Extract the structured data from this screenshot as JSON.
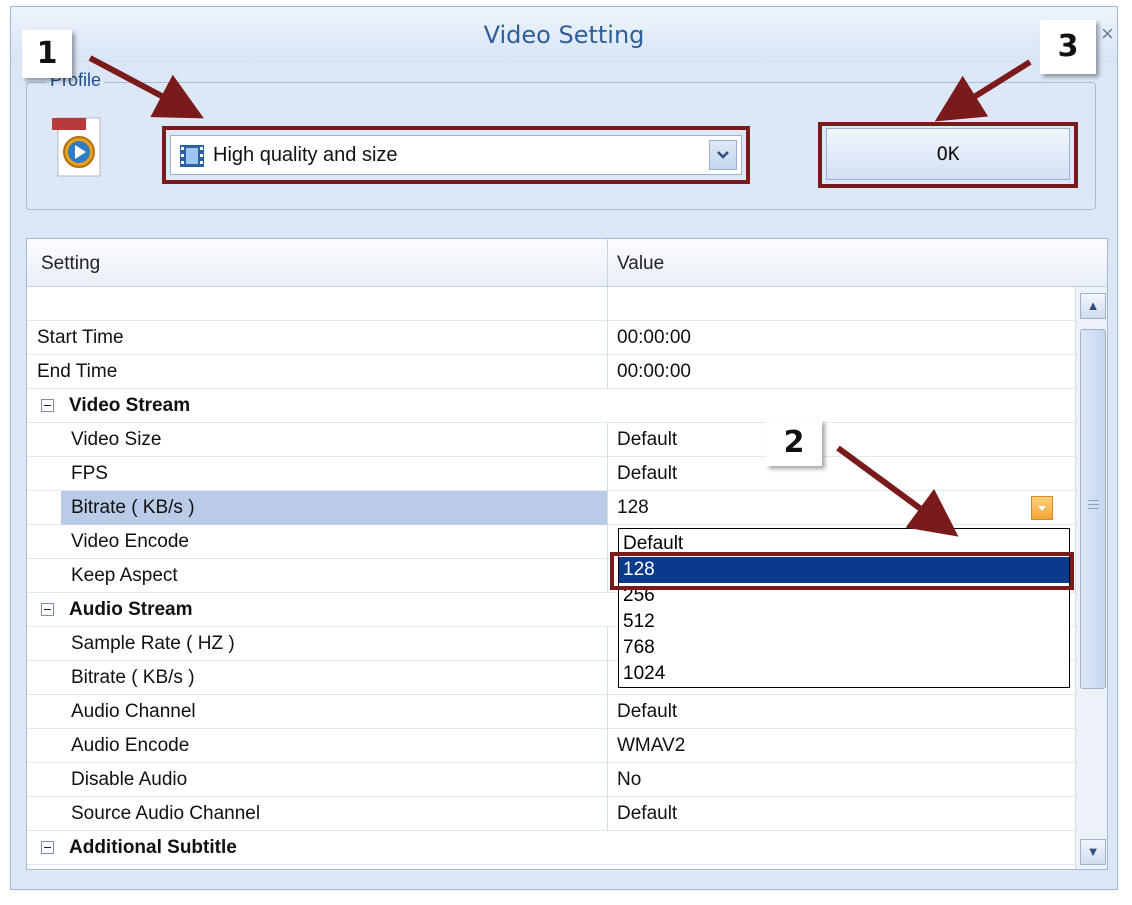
{
  "window": {
    "title": "Video Setting",
    "close_glyph": "×"
  },
  "profile": {
    "legend": "Profile",
    "icon": "wmv-file-icon",
    "selected": "High quality and size",
    "ok_label": "OK"
  },
  "grid": {
    "headers": {
      "setting": "Setting",
      "value": "Value"
    },
    "rows": [
      {
        "name": "",
        "value": ""
      },
      {
        "name": "Start Time",
        "value": "00:00:00"
      },
      {
        "name": "End Time",
        "value": "00:00:00"
      },
      {
        "name": "Video Stream",
        "value": ""
      },
      {
        "name": "Video Size",
        "value": "Default"
      },
      {
        "name": "FPS",
        "value": "Default"
      },
      {
        "name": "Bitrate ( KB/s )",
        "value": "128"
      },
      {
        "name": "Video Encode",
        "value": ""
      },
      {
        "name": "Keep Aspect",
        "value": ""
      },
      {
        "name": "Audio Stream",
        "value": ""
      },
      {
        "name": "Sample Rate ( HZ )",
        "value": ""
      },
      {
        "name": "Bitrate ( KB/s )",
        "value": ""
      },
      {
        "name": "Audio Channel",
        "value": "Default"
      },
      {
        "name": "Audio Encode",
        "value": "WMAV2"
      },
      {
        "name": "Disable Audio",
        "value": "No"
      },
      {
        "name": "Source Audio Channel",
        "value": "Default"
      },
      {
        "name": "Additional Subtitle",
        "value": ""
      }
    ]
  },
  "bitrate_options": [
    "Default",
    "128",
    "256",
    "512",
    "768",
    "1024"
  ],
  "bitrate_selected": "128",
  "callouts": {
    "one": "1",
    "two": "2",
    "three": "3"
  },
  "colors": {
    "highlight": "#7a1a1a",
    "arrow": "#7a1a1a",
    "selected_option": "#0a3a8c"
  }
}
